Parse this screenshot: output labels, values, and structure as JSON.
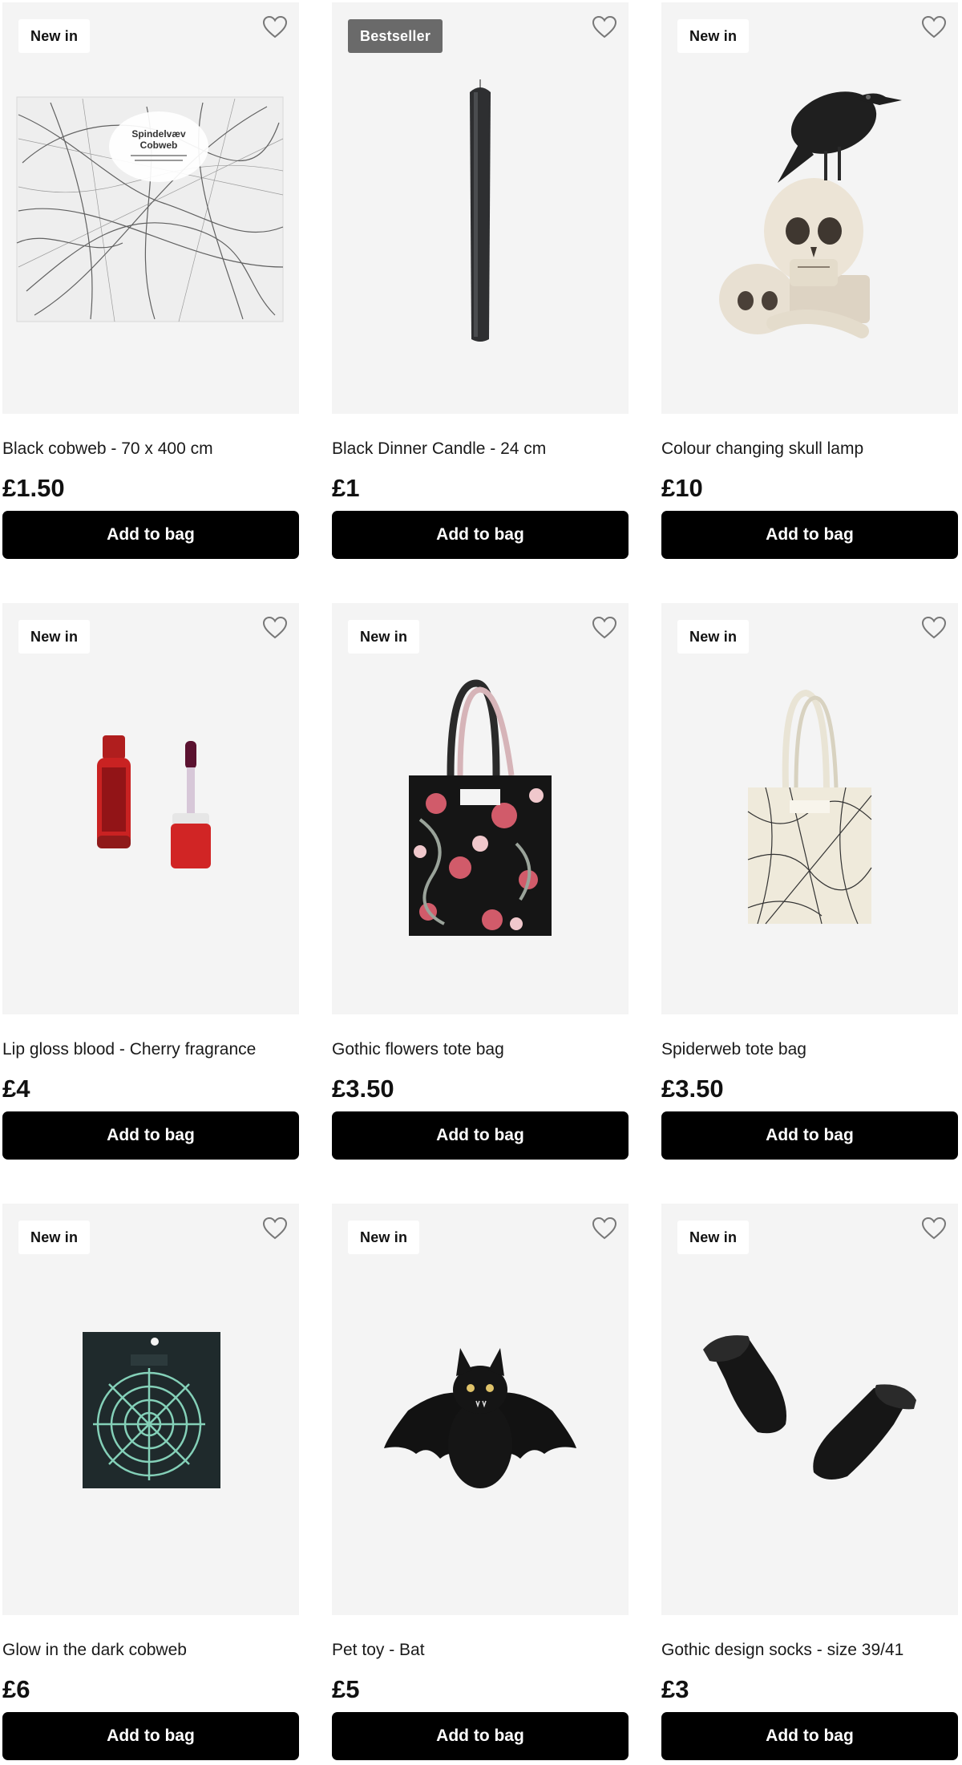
{
  "products": [
    {
      "badge": "New in",
      "title": "Black cobweb - 70 x 400 cm",
      "price": "£1.50",
      "button": "Add to bag",
      "package_title": "Spindelvæv\nCobweb",
      "image": "cobweb-pack-image"
    },
    {
      "badge": "Bestseller",
      "title": "Black Dinner Candle - 24 cm",
      "price": "£1",
      "button": "Add to bag",
      "image": "candle-image"
    },
    {
      "badge": "New in",
      "title": "Colour changing skull lamp",
      "price": "£10",
      "button": "Add to bag",
      "image": "skull-lamp-image"
    },
    {
      "badge": "New in",
      "title": "Lip gloss blood - Cherry fragrance",
      "price": "£4",
      "button": "Add to bag",
      "image": "lip-gloss-image"
    },
    {
      "badge": "New in",
      "title": "Gothic flowers tote bag",
      "price": "£3.50",
      "button": "Add to bag",
      "image": "tote-flowers-image"
    },
    {
      "badge": "New in",
      "title": "Spiderweb tote bag",
      "price": "£3.50",
      "button": "Add to bag",
      "image": "tote-spiderweb-image"
    },
    {
      "badge": "New in",
      "title": "Glow in the dark cobweb",
      "price": "£6",
      "button": "Add to bag",
      "image": "glow-cobweb-image"
    },
    {
      "badge": "New in",
      "title": "Pet toy - Bat",
      "price": "£5",
      "button": "Add to bag",
      "image": "bat-toy-image"
    },
    {
      "badge": "New in",
      "title": "Gothic design socks - size 39/41",
      "price": "£3",
      "button": "Add to bag",
      "image": "socks-image"
    }
  ],
  "icons": {
    "favourite": "heart-outline-icon"
  },
  "colors": {
    "button_bg": "#000000",
    "tile_bg": "#f4f4f4",
    "bestseller_badge": "#6a6a6a"
  }
}
